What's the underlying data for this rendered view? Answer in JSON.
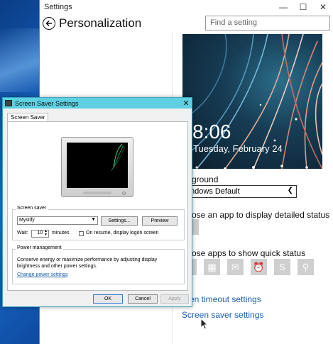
{
  "settings": {
    "window_title": "Settings",
    "controls": {
      "minimize": "—",
      "maximize": "☐",
      "close": "✕"
    },
    "page_title": "Personalization",
    "search_placeholder": "Find a setting",
    "lock_screen": {
      "time": "8:06",
      "date": "Tuesday, February 24"
    },
    "background": {
      "label": "ground",
      "value": "ndows Default"
    },
    "detailed_status_label": "ose an app to display detailed status",
    "quick_status_label": "ose apps to show quick status",
    "quick_icons": [
      "empty-slot",
      "calendar-icon",
      "mail-icon",
      "alarm-icon",
      "skype-icon",
      "search-icon"
    ],
    "links": {
      "timeout": "en timeout settings",
      "screensaver": "Screen saver settings"
    }
  },
  "dialog": {
    "title": "Screen Saver Settings",
    "close": "✕",
    "tab": "Screen Saver",
    "screen_saver_group": "Screen saver",
    "selected_saver": "Mystify",
    "settings_button": "Settings...",
    "preview_button": "Preview",
    "wait_label": "Wait:",
    "wait_value": "10",
    "minutes_label": "minutes",
    "resume_label": "On resume, display logon screen",
    "power_group": "Power management",
    "power_text": "Conserve energy or maximize performance by adjusting display brightness and other power settings.",
    "power_link": "Change power settings",
    "ok": "OK",
    "cancel": "Cancel",
    "apply": "Apply"
  },
  "colors": {
    "accent": "#1b5eaa",
    "dialog_title": "#5ed0e2",
    "desktop": "#1560b8"
  }
}
